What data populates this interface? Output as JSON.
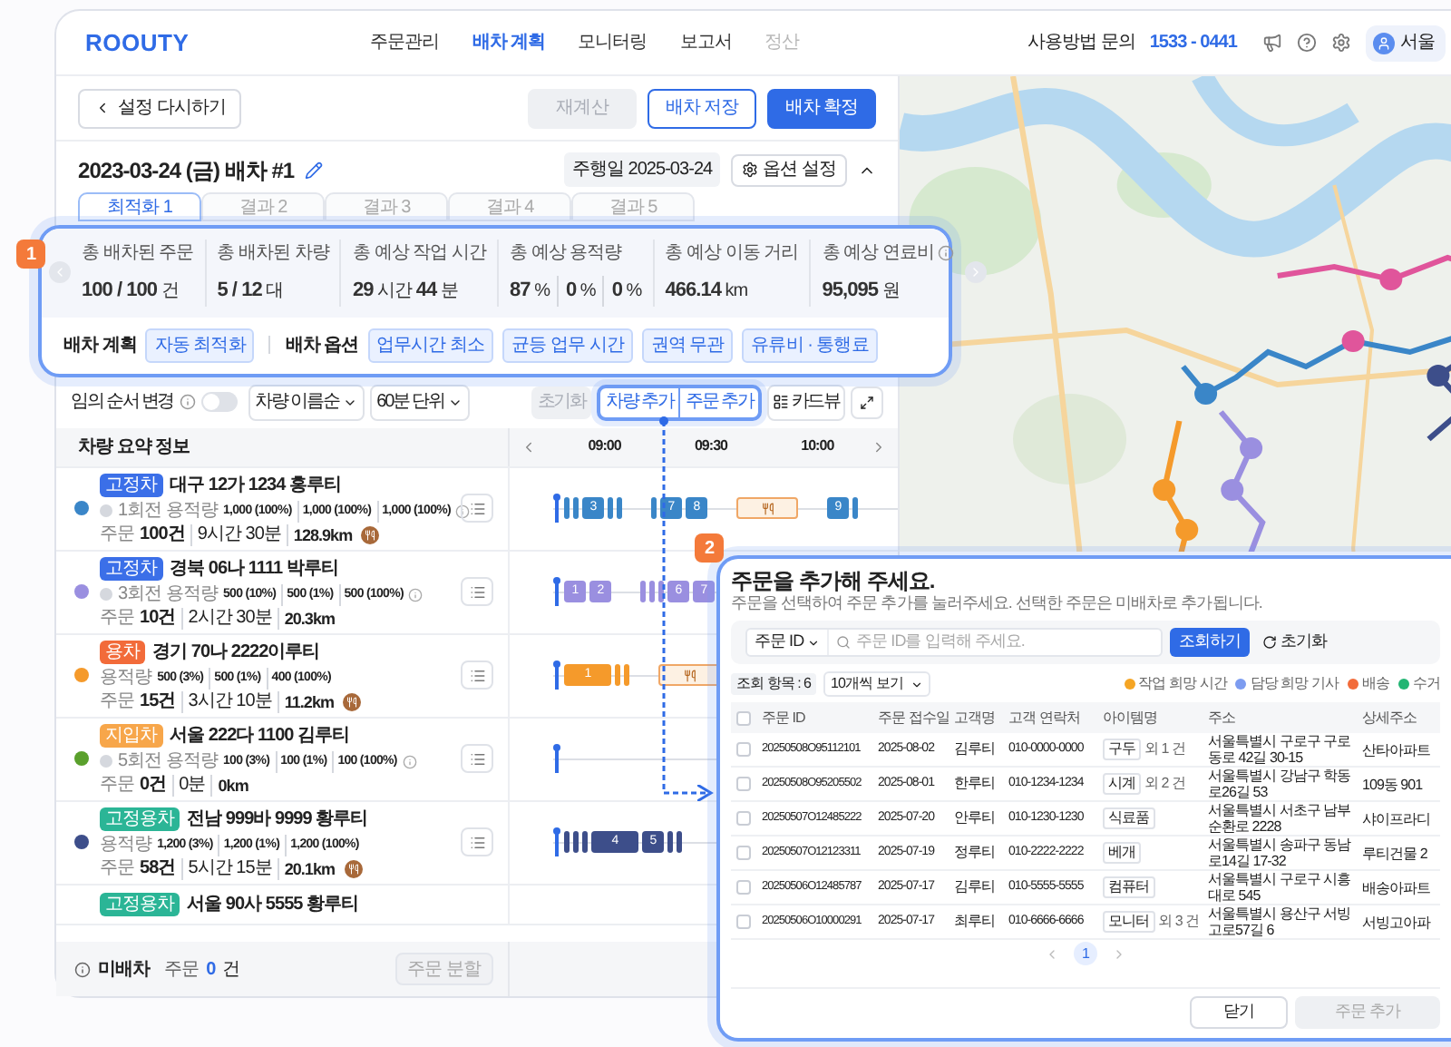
{
  "header": {
    "logo": "ROOUTY",
    "nav": [
      {
        "label": "주문관리",
        "selected": false,
        "disabled": false
      },
      {
        "label": "배차 계획",
        "selected": true,
        "disabled": false
      },
      {
        "label": "모니터링",
        "selected": false,
        "disabled": false
      },
      {
        "label": "보고서",
        "selected": false,
        "disabled": false
      },
      {
        "label": "정산",
        "selected": false,
        "disabled": true
      }
    ],
    "support_label": "사용방법 문의",
    "support_phone": "1533 - 0441",
    "user": "서울"
  },
  "toolbar": {
    "back": "설정 다시하기",
    "buttons": [
      {
        "label": "재계산",
        "kind": "disabled"
      },
      {
        "label": "배차 저장",
        "kind": "outline"
      },
      {
        "label": "배차 확정",
        "kind": "primary"
      }
    ]
  },
  "plan": {
    "title": "2023-03-24 (금) 배차 #1",
    "run_date": "주행일 2025-03-24",
    "options_button": "옵션 설정",
    "expanded": true
  },
  "tabs": [
    {
      "label": "최적화 1",
      "selected": true
    },
    {
      "label": "결과 2",
      "selected": false
    },
    {
      "label": "결과 3",
      "selected": false
    },
    {
      "label": "결과 4",
      "selected": false
    },
    {
      "label": "결과 5",
      "selected": false
    }
  ],
  "summary": {
    "badge": "1",
    "stats": [
      {
        "label": "총 배차된 주문",
        "values": [
          "**100 / 100** 건"
        ],
        "info": false
      },
      {
        "label": "총 배차된 차량",
        "values": [
          "**5 / 12** 대"
        ],
        "info": false
      },
      {
        "label": "총 예상 작업 시간",
        "values": [
          "**29** 시간 **44** 분"
        ],
        "info": false
      },
      {
        "label": "총 예상 용적량",
        "values": [
          "**87** %",
          "**0** %",
          "**0** %"
        ],
        "info": false
      },
      {
        "label": "총 예상 이동 거리",
        "values": [
          "**466.14** km"
        ],
        "info": false
      },
      {
        "label": "총 예상 연료비",
        "values": [
          "**95,095** 원"
        ],
        "info": true
      }
    ],
    "plan_label": "배차 계획",
    "plan_chips": [
      "자동 최적화"
    ],
    "options_label": "배차 옵션",
    "option_chips": [
      "업무시간 최소",
      "균등 업무 시간",
      "권역 무관",
      "유류비 · 통행료"
    ]
  },
  "controls": {
    "reorder_label": "임의 순서 변경",
    "reorder_on": false,
    "sort": "차량 이름순",
    "unit": "60분 단위",
    "reset": "초기화",
    "add_vehicle": "차량 추가",
    "add_order": "주문 추가",
    "card_view": "카드뷰"
  },
  "timeline_header": {
    "title": "차량 요약 정보",
    "times": [
      "09:00",
      "09:30",
      "10:00"
    ]
  },
  "vehicles": [
    {
      "tag": {
        "label": "고정차",
        "color": "#3b6fe8"
      },
      "name": "대구 12가 1234 홍루티",
      "color": "#3a86c8",
      "cycle_icon": true,
      "capacity_label": "1회전 용적량",
      "capacity": [
        "1,000 (100%)",
        "1,000 (100%)",
        "1,000 (100%)"
      ],
      "orders_label": "주문",
      "orders": "100건",
      "duration": "9시간 30분",
      "distance": "128.9km",
      "meal": true,
      "timeline": [
        {
          "kind": "start"
        },
        {
          "kind": "stop"
        },
        {
          "kind": "stop"
        },
        {
          "kind": "stop",
          "label": "3"
        },
        {
          "kind": "stop"
        },
        {
          "kind": "stop"
        },
        {
          "kind": "space"
        },
        {
          "kind": "stop"
        },
        {
          "kind": "stop",
          "label": "7"
        },
        {
          "kind": "stop",
          "label": "8"
        },
        {
          "kind": "space"
        },
        {
          "kind": "meal"
        },
        {
          "kind": "space"
        },
        {
          "kind": "stop",
          "label": "9"
        },
        {
          "kind": "stop"
        }
      ]
    },
    {
      "tag": {
        "label": "고정차",
        "color": "#3b6fe8"
      },
      "name": "경북 06나 1111 박루티",
      "color": "#9a8fe0",
      "cycle_icon": true,
      "capacity_label": "3회전 용적량",
      "capacity": [
        "500 (10%)",
        "500 (1%)",
        "500 (100%)"
      ],
      "orders_label": "주문",
      "orders": "10건",
      "duration": "2시간 30분",
      "distance": "20.3km",
      "meal": false,
      "timeline": [
        {
          "kind": "start"
        },
        {
          "kind": "stop",
          "label": "1"
        },
        {
          "kind": "stop",
          "label": "2"
        },
        {
          "kind": "space"
        },
        {
          "kind": "stop"
        },
        {
          "kind": "stop"
        },
        {
          "kind": "stop"
        },
        {
          "kind": "stop",
          "label": "6"
        },
        {
          "kind": "stop",
          "label": "7"
        }
      ]
    },
    {
      "tag": {
        "label": "용차",
        "color": "#f26b3a"
      },
      "name": "경기 70나 2222이루티",
      "color": "#f59a2b",
      "cycle_icon": false,
      "capacity_label": "용적량",
      "capacity": [
        "500 (3%)",
        "500 (1%)",
        "400 (100%)"
      ],
      "orders_label": "주문",
      "orders": "15건",
      "duration": "3시간 10분",
      "distance": "11.2km",
      "meal": true,
      "timeline": [
        {
          "kind": "start"
        },
        {
          "kind": "long",
          "label": "1"
        },
        {
          "kind": "stop"
        },
        {
          "kind": "stop"
        },
        {
          "kind": "space"
        },
        {
          "kind": "meal"
        }
      ]
    },
    {
      "tag": {
        "label": "지입차",
        "color": "#f7a64a"
      },
      "name": "서울 222다 1100 김루티",
      "color": "#5aa02c",
      "cycle_icon": true,
      "capacity_label": "5회전 용적량",
      "capacity": [
        "100 (3%)",
        "100 (1%)",
        "100 (100%)"
      ],
      "orders_label": "주문",
      "orders": "0건",
      "duration": "0분",
      "distance": "0km",
      "meal": false,
      "timeline": [
        {
          "kind": "start"
        }
      ]
    },
    {
      "tag": {
        "label": "고정용차",
        "color": "#2bb596"
      },
      "name": "전남 999바 9999 황루티",
      "color": "#3d4e8a",
      "cycle_icon": false,
      "capacity_label": "용적량",
      "capacity": [
        "1,200 (3%)",
        "1,200 (1%)",
        "1,200 (100%)"
      ],
      "orders_label": "주문",
      "orders": "58건",
      "duration": "5시간 15분",
      "distance": "20.1km",
      "meal": true,
      "timeline": [
        {
          "kind": "start"
        },
        {
          "kind": "stop"
        },
        {
          "kind": "stop"
        },
        {
          "kind": "stop"
        },
        {
          "kind": "long",
          "label": "4"
        },
        {
          "kind": "stop",
          "label": "5"
        },
        {
          "kind": "stop"
        },
        {
          "kind": "stop"
        }
      ]
    },
    {
      "tag": {
        "label": "고정용차",
        "color": "#2bb596"
      },
      "name": "서울 90사 5555 황루티"
    }
  ],
  "unassigned": {
    "label": "미배차",
    "orders_label": "주문",
    "count": "0",
    "unit": "건",
    "split_button": "주문 분할"
  },
  "dialog": {
    "badge": "2",
    "title": "주문을 추가해 주세요.",
    "subtitle": "주문을 선택하여 주문 추가를 눌러주세요. 선택한 주문은 미배차로 추가됩니다.",
    "filter": "주문 ID",
    "search_placeholder": "주문 ID를 입력해 주세요.",
    "search_button": "조회하기",
    "reset": "초기화",
    "count": "조회 항목 : 6",
    "page_size": "10개씩 보기",
    "legend": [
      {
        "label": "작업 희망 시간",
        "color": "#f5a524"
      },
      {
        "label": "담당 희망 기사",
        "color": "#7d9cf0"
      },
      {
        "label": "배송",
        "color": "#f26b3a"
      },
      {
        "label": "수거",
        "color": "#22b573"
      }
    ],
    "select_all": false,
    "columns": [
      "주문 ID",
      "주문 접수일",
      "고객명",
      "고객 연락처",
      "아이템명",
      "주소",
      "상세주소"
    ],
    "rows": [
      {
        "checked": false,
        "id": "20250508O95112101",
        "date": "2025-08-02",
        "name": "김루티",
        "phone": "010-0000-0000",
        "item": "구두",
        "extra": "외 1 건",
        "address": "서울특별시 구로구 구로동로 42길 30-15",
        "detail": "산타아파트"
      },
      {
        "checked": false,
        "id": "20250508O95205502",
        "date": "2025-08-01",
        "name": "한루티",
        "phone": "010-1234-1234",
        "item": "시계",
        "extra": "외 2 건",
        "address": "서울특별시 강남구 학동로26길 53",
        "detail": "109동 901"
      },
      {
        "checked": false,
        "id": "20250507O12485222",
        "date": "2025-07-20",
        "name": "안루티",
        "phone": "010-1230-1230",
        "item": "식료품",
        "address": "서울특별시 서초구 남부순환로 2228",
        "detail": "샤이프라디"
      },
      {
        "checked": false,
        "id": "20250507O12123311",
        "date": "2025-07-19",
        "name": "정루티",
        "phone": "010-2222-2222",
        "item": "베개",
        "address": "서울특별시 송파구 동남로14길 17-32",
        "detail": "루티건물 2"
      },
      {
        "checked": false,
        "id": "20250506O12485787",
        "date": "2025-07-17",
        "name": "김루티",
        "phone": "010-5555-5555",
        "item": "컴퓨터",
        "address": "서울특별시 구로구 시흥대로 545",
        "detail": "배송아파트"
      },
      {
        "checked": false,
        "id": "20250506O10000291",
        "date": "2025-07-17",
        "name": "최루티",
        "phone": "010-6666-6666",
        "item": "모니터",
        "extra": "외 3 건",
        "address": "서울특별시 용산구 서빙고로57길 6",
        "detail": "서빙고아파"
      }
    ],
    "pages": [
      {
        "label": "1",
        "selected": true
      }
    ],
    "close": "닫기",
    "submit": "주문 추가"
  }
}
